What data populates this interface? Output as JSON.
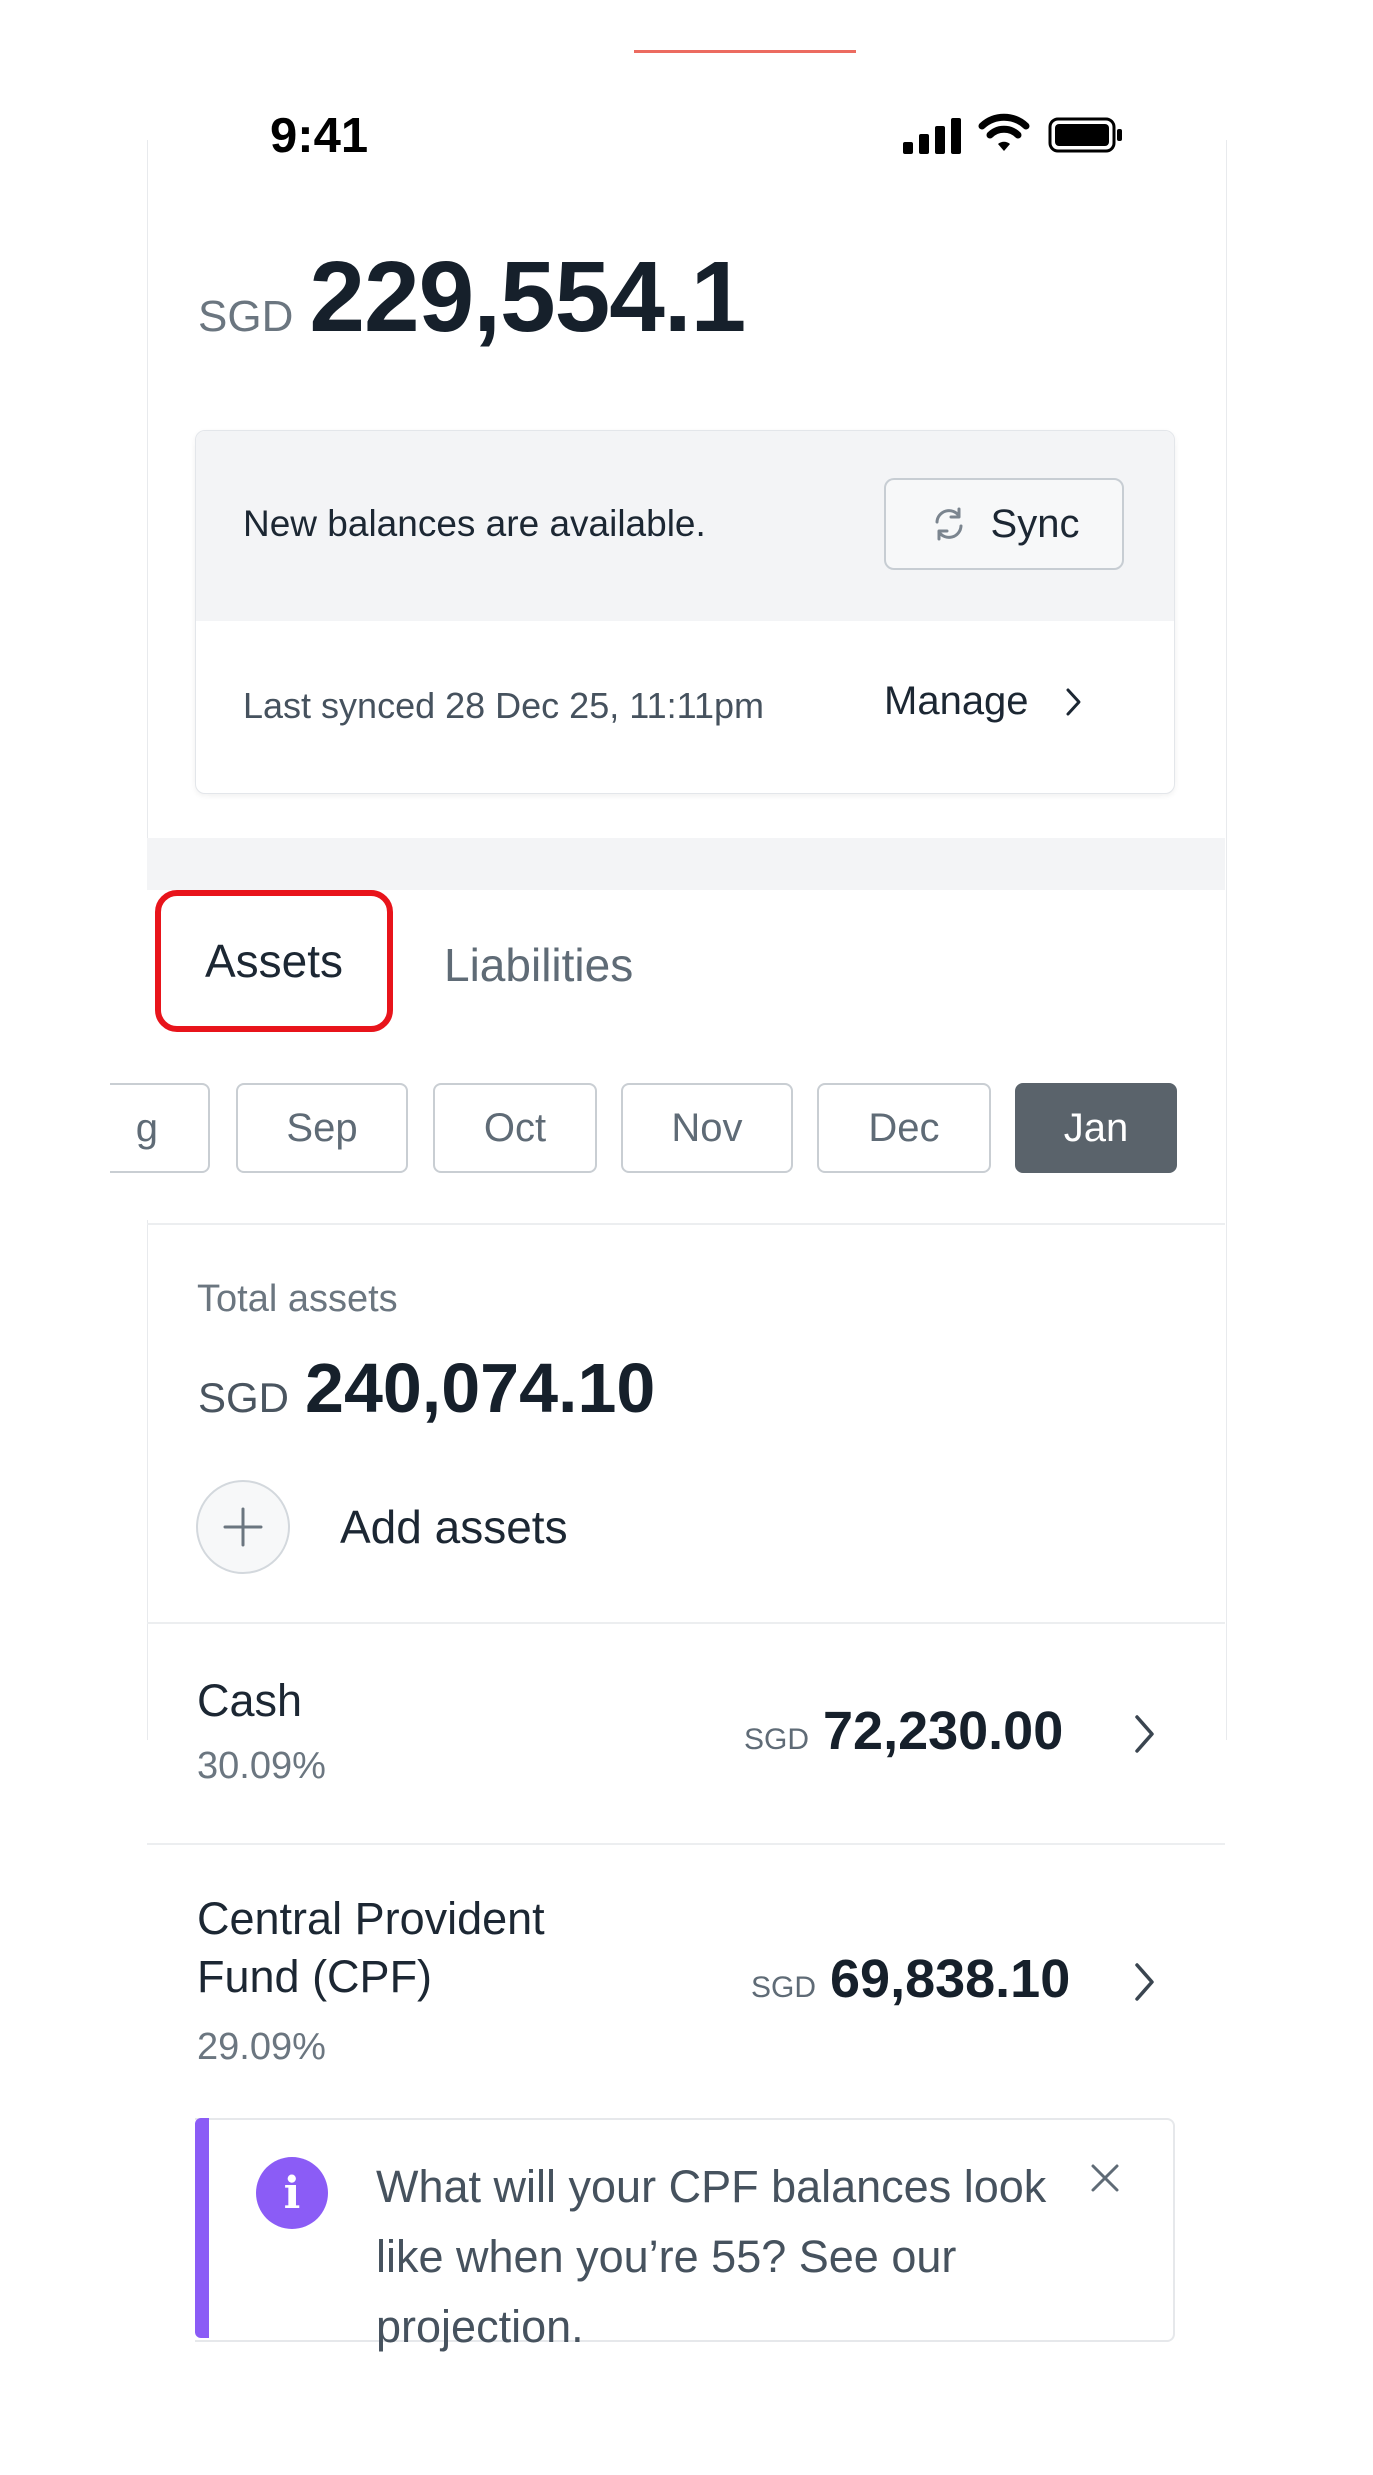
{
  "status_bar": {
    "time": "9:41"
  },
  "summary": {
    "currency": "SGD",
    "net_worth": "229,554.1"
  },
  "sync_card": {
    "message": "New balances are available.",
    "sync_label": "Sync",
    "last_synced": "Last synced 28 Dec 25, 11:11pm",
    "manage_label": "Manage"
  },
  "tabs": [
    {
      "label": "Assets",
      "selected": true
    },
    {
      "label": "Liabilities",
      "selected": false
    }
  ],
  "months": {
    "partial": "g",
    "items": [
      "Sep",
      "Oct",
      "Nov",
      "Dec",
      "Jan"
    ],
    "selected": "Jan"
  },
  "totals": {
    "label": "Total assets",
    "currency": "SGD",
    "amount": "240,074.10",
    "add_label": "Add assets"
  },
  "assets": [
    {
      "name": "Cash",
      "percent": "30.09%",
      "currency": "SGD",
      "amount": "72,230.00"
    },
    {
      "name_line1": "Central Provident",
      "name_line2": "Fund (CPF)",
      "percent": "29.09%",
      "currency": "SGD",
      "amount": "69,838.10"
    }
  ],
  "info_banner": {
    "text": "What will your CPF balances look like when you’re 55? See our projection.",
    "accent_color": "#8b5cf6"
  },
  "colors": {
    "highlight": "#e8141b",
    "top_accent": "#ec6b60",
    "chip_active": "#5a636b"
  }
}
